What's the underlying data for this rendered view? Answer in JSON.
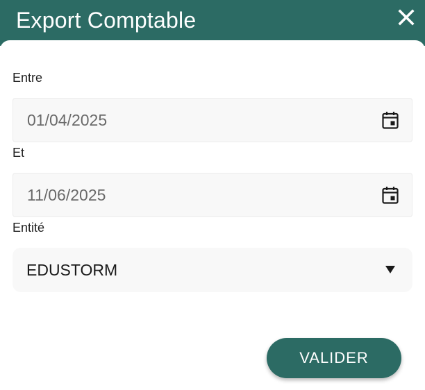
{
  "dialog": {
    "title": "Export Comptable",
    "close_icon": "close-icon"
  },
  "form": {
    "start": {
      "label": "Entre",
      "value": "01/04/2025",
      "icon": "calendar-icon"
    },
    "end": {
      "label": "Et",
      "value": "11/06/2025",
      "icon": "calendar-icon"
    },
    "entity": {
      "label": "Entité",
      "value": "EDUSTORM",
      "icon": "dropdown-arrow-icon"
    },
    "submit_label": "VALIDER"
  },
  "colors": {
    "primary": "#2c6b64",
    "field_background": "#f8f8f8",
    "text": "#222222"
  }
}
